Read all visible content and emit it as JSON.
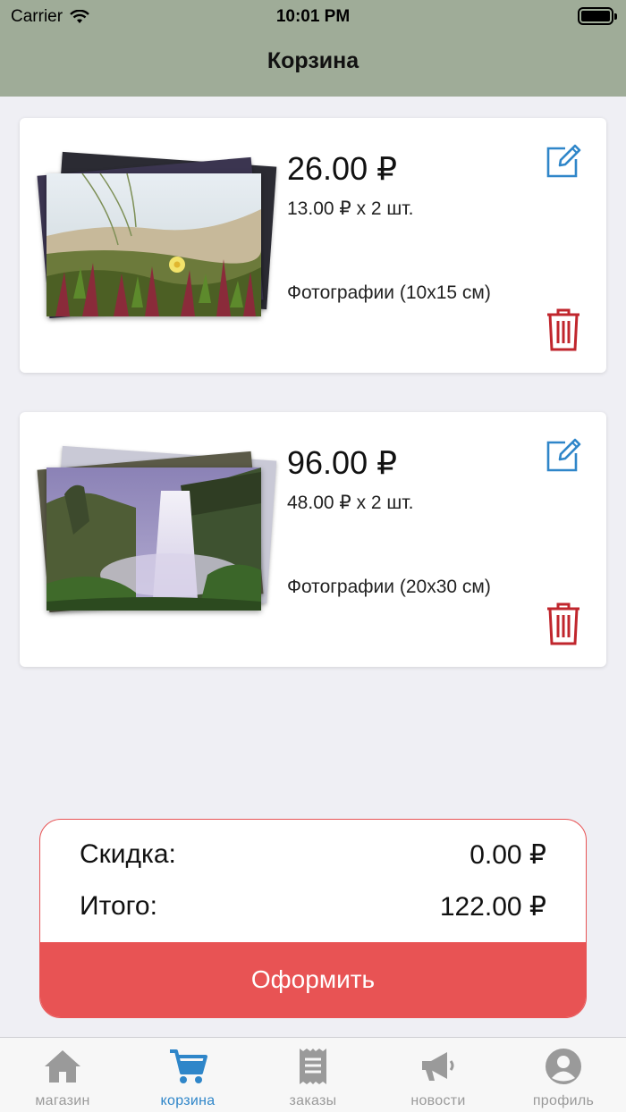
{
  "status_bar": {
    "carrier": "Carrier",
    "time": "10:01 PM"
  },
  "nav": {
    "title": "Корзина"
  },
  "cart_items": [
    {
      "price": "26.00 ₽",
      "unit_line": "13.00 ₽ x 2 шт.",
      "description": "Фотографии (10x15 см)"
    },
    {
      "price": "96.00 ₽",
      "unit_line": "48.00 ₽ x 2 шт.",
      "description": "Фотографии (20x30 см)"
    }
  ],
  "summary": {
    "discount_label": "Скидка:",
    "discount_value": "0.00 ₽",
    "total_label": "Итого:",
    "total_value": "122.00 ₽",
    "checkout_label": "Оформить"
  },
  "tabs": [
    {
      "label": "магазин",
      "icon": "home-icon"
    },
    {
      "label": "корзина",
      "icon": "cart-icon"
    },
    {
      "label": "заказы",
      "icon": "receipt-icon"
    },
    {
      "label": "новости",
      "icon": "megaphone-icon"
    },
    {
      "label": "профиль",
      "icon": "profile-icon"
    }
  ],
  "colors": {
    "accent": "#2f86c9",
    "danger": "#e85354",
    "header": "#9fac98",
    "delete": "#c0262d"
  }
}
